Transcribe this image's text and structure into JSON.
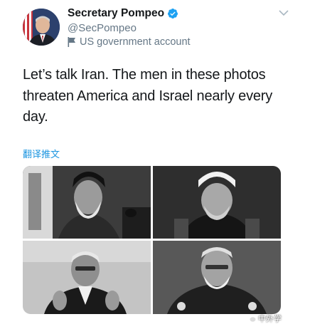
{
  "tweet": {
    "display_name": "Secretary Pompeo",
    "handle": "@SecPompeo",
    "account_label": "US government account",
    "text": "Let’s talk Iran. The men in these photos threaten America and Israel nearly every day.",
    "translate_link": "翻译推文"
  },
  "watermark": {
    "text": "中外学"
  },
  "icons": {
    "verified": "verified-badge-icon",
    "account_label": "flag-icon",
    "menu": "chevron-down-icon"
  },
  "colors": {
    "link": "#1b95e0",
    "verified": "#1da1f2",
    "secondary_text": "#657786"
  }
}
